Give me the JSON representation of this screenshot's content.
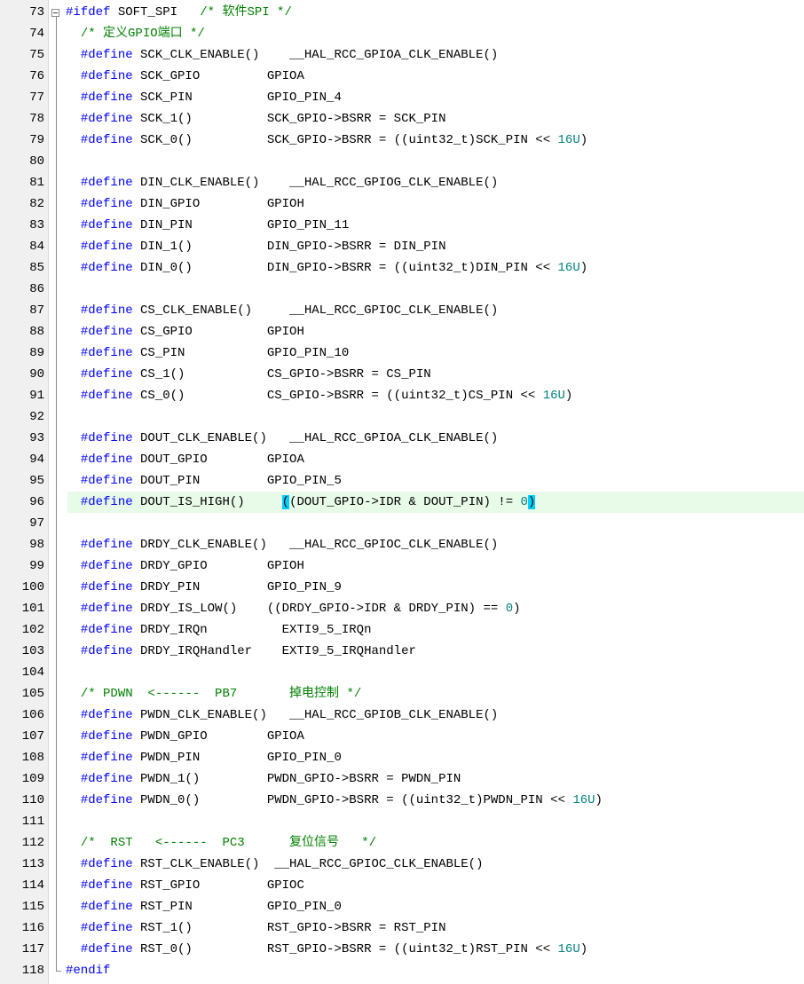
{
  "editor": {
    "line_numbers": [
      "73",
      "74",
      "75",
      "76",
      "77",
      "78",
      "79",
      "80",
      "81",
      "82",
      "83",
      "84",
      "85",
      "86",
      "87",
      "88",
      "89",
      "90",
      "91",
      "92",
      "93",
      "94",
      "95",
      "96",
      "97",
      "98",
      "99",
      "100",
      "101",
      "102",
      "103",
      "104",
      "105",
      "106",
      "107",
      "108",
      "109",
      "110",
      "111",
      "112",
      "113",
      "114",
      "115",
      "116",
      "117",
      "118"
    ],
    "current_line": "96",
    "lines": [
      [
        {
          "t": "kw",
          "v": "#ifdef"
        },
        {
          "t": "tx",
          "v": " SOFT_SPI   "
        },
        {
          "t": "cm",
          "v": "/* 软件SPI */"
        }
      ],
      [
        {
          "t": "tx",
          "v": "  "
        },
        {
          "t": "cm",
          "v": "/* 定义GPIO端口 */"
        }
      ],
      [
        {
          "t": "tx",
          "v": "  "
        },
        {
          "t": "kw",
          "v": "#define"
        },
        {
          "t": "tx",
          "v": " SCK_CLK_ENABLE()    __HAL_RCC_GPIOA_CLK_ENABLE()"
        }
      ],
      [
        {
          "t": "tx",
          "v": "  "
        },
        {
          "t": "kw",
          "v": "#define"
        },
        {
          "t": "tx",
          "v": " SCK_GPIO         GPIOA"
        }
      ],
      [
        {
          "t": "tx",
          "v": "  "
        },
        {
          "t": "kw",
          "v": "#define"
        },
        {
          "t": "tx",
          "v": " SCK_PIN          GPIO_PIN_4"
        }
      ],
      [
        {
          "t": "tx",
          "v": "  "
        },
        {
          "t": "kw",
          "v": "#define"
        },
        {
          "t": "tx",
          "v": " SCK_1()          SCK_GPIO->BSRR = SCK_PIN"
        }
      ],
      [
        {
          "t": "tx",
          "v": "  "
        },
        {
          "t": "kw",
          "v": "#define"
        },
        {
          "t": "tx",
          "v": " SCK_0()          SCK_GPIO->BSRR = ((uint32_t)SCK_PIN << "
        },
        {
          "t": "nm",
          "v": "16U"
        },
        {
          "t": "tx",
          "v": ")"
        }
      ],
      [],
      [
        {
          "t": "tx",
          "v": "  "
        },
        {
          "t": "kw",
          "v": "#define"
        },
        {
          "t": "tx",
          "v": " DIN_CLK_ENABLE()    __HAL_RCC_GPIOG_CLK_ENABLE()"
        }
      ],
      [
        {
          "t": "tx",
          "v": "  "
        },
        {
          "t": "kw",
          "v": "#define"
        },
        {
          "t": "tx",
          "v": " DIN_GPIO         GPIOH"
        }
      ],
      [
        {
          "t": "tx",
          "v": "  "
        },
        {
          "t": "kw",
          "v": "#define"
        },
        {
          "t": "tx",
          "v": " DIN_PIN          GPIO_PIN_11"
        }
      ],
      [
        {
          "t": "tx",
          "v": "  "
        },
        {
          "t": "kw",
          "v": "#define"
        },
        {
          "t": "tx",
          "v": " DIN_1()          DIN_GPIO->BSRR = DIN_PIN"
        }
      ],
      [
        {
          "t": "tx",
          "v": "  "
        },
        {
          "t": "kw",
          "v": "#define"
        },
        {
          "t": "tx",
          "v": " DIN_0()          DIN_GPIO->BSRR = ((uint32_t)DIN_PIN << "
        },
        {
          "t": "nm",
          "v": "16U"
        },
        {
          "t": "tx",
          "v": ")"
        }
      ],
      [],
      [
        {
          "t": "tx",
          "v": "  "
        },
        {
          "t": "kw",
          "v": "#define"
        },
        {
          "t": "tx",
          "v": " CS_CLK_ENABLE()     __HAL_RCC_GPIOC_CLK_ENABLE()"
        }
      ],
      [
        {
          "t": "tx",
          "v": "  "
        },
        {
          "t": "kw",
          "v": "#define"
        },
        {
          "t": "tx",
          "v": " CS_GPIO          GPIOH"
        }
      ],
      [
        {
          "t": "tx",
          "v": "  "
        },
        {
          "t": "kw",
          "v": "#define"
        },
        {
          "t": "tx",
          "v": " CS_PIN           GPIO_PIN_10"
        }
      ],
      [
        {
          "t": "tx",
          "v": "  "
        },
        {
          "t": "kw",
          "v": "#define"
        },
        {
          "t": "tx",
          "v": " CS_1()           CS_GPIO->BSRR = CS_PIN"
        }
      ],
      [
        {
          "t": "tx",
          "v": "  "
        },
        {
          "t": "kw",
          "v": "#define"
        },
        {
          "t": "tx",
          "v": " CS_0()           CS_GPIO->BSRR = ((uint32_t)CS_PIN << "
        },
        {
          "t": "nm",
          "v": "16U"
        },
        {
          "t": "tx",
          "v": ")"
        }
      ],
      [],
      [
        {
          "t": "tx",
          "v": "  "
        },
        {
          "t": "kw",
          "v": "#define"
        },
        {
          "t": "tx",
          "v": " DOUT_CLK_ENABLE()   __HAL_RCC_GPIOA_CLK_ENABLE()"
        }
      ],
      [
        {
          "t": "tx",
          "v": "  "
        },
        {
          "t": "kw",
          "v": "#define"
        },
        {
          "t": "tx",
          "v": " DOUT_GPIO        GPIOA"
        }
      ],
      [
        {
          "t": "tx",
          "v": "  "
        },
        {
          "t": "kw",
          "v": "#define"
        },
        {
          "t": "tx",
          "v": " DOUT_PIN         GPIO_PIN_5"
        }
      ],
      [
        {
          "t": "tx",
          "v": "  "
        },
        {
          "t": "kw",
          "v": "#define"
        },
        {
          "t": "tx",
          "v": " DOUT_IS_HIGH()     "
        },
        {
          "t": "brace",
          "v": "("
        },
        {
          "t": "tx",
          "v": "(DOUT_GPIO->IDR & DOUT_PIN) != "
        },
        {
          "t": "nm",
          "v": "0"
        },
        {
          "t": "brace",
          "v": ")"
        }
      ],
      [],
      [
        {
          "t": "tx",
          "v": "  "
        },
        {
          "t": "kw",
          "v": "#define"
        },
        {
          "t": "tx",
          "v": " DRDY_CLK_ENABLE()   __HAL_RCC_GPIOC_CLK_ENABLE()"
        }
      ],
      [
        {
          "t": "tx",
          "v": "  "
        },
        {
          "t": "kw",
          "v": "#define"
        },
        {
          "t": "tx",
          "v": " DRDY_GPIO        GPIOH"
        }
      ],
      [
        {
          "t": "tx",
          "v": "  "
        },
        {
          "t": "kw",
          "v": "#define"
        },
        {
          "t": "tx",
          "v": " DRDY_PIN         GPIO_PIN_9"
        }
      ],
      [
        {
          "t": "tx",
          "v": "  "
        },
        {
          "t": "kw",
          "v": "#define"
        },
        {
          "t": "tx",
          "v": " DRDY_IS_LOW()    ((DRDY_GPIO->IDR & DRDY_PIN) == "
        },
        {
          "t": "nm",
          "v": "0"
        },
        {
          "t": "tx",
          "v": ")"
        }
      ],
      [
        {
          "t": "tx",
          "v": "  "
        },
        {
          "t": "kw",
          "v": "#define"
        },
        {
          "t": "tx",
          "v": " DRDY_IRQn          EXTI9_5_IRQn"
        }
      ],
      [
        {
          "t": "tx",
          "v": "  "
        },
        {
          "t": "kw",
          "v": "#define"
        },
        {
          "t": "tx",
          "v": " DRDY_IRQHandler    EXTI9_5_IRQHandler"
        }
      ],
      [],
      [
        {
          "t": "tx",
          "v": "  "
        },
        {
          "t": "cm",
          "v": "/* PDWN  <------  PB7       掉电控制 */"
        }
      ],
      [
        {
          "t": "tx",
          "v": "  "
        },
        {
          "t": "kw",
          "v": "#define"
        },
        {
          "t": "tx",
          "v": " PWDN_CLK_ENABLE()   __HAL_RCC_GPIOB_CLK_ENABLE()"
        }
      ],
      [
        {
          "t": "tx",
          "v": "  "
        },
        {
          "t": "kw",
          "v": "#define"
        },
        {
          "t": "tx",
          "v": " PWDN_GPIO        GPIOA"
        }
      ],
      [
        {
          "t": "tx",
          "v": "  "
        },
        {
          "t": "kw",
          "v": "#define"
        },
        {
          "t": "tx",
          "v": " PWDN_PIN         GPIO_PIN_0"
        }
      ],
      [
        {
          "t": "tx",
          "v": "  "
        },
        {
          "t": "kw",
          "v": "#define"
        },
        {
          "t": "tx",
          "v": " PWDN_1()         PWDN_GPIO->BSRR = PWDN_PIN"
        }
      ],
      [
        {
          "t": "tx",
          "v": "  "
        },
        {
          "t": "kw",
          "v": "#define"
        },
        {
          "t": "tx",
          "v": " PWDN_0()         PWDN_GPIO->BSRR = ((uint32_t)PWDN_PIN << "
        },
        {
          "t": "nm",
          "v": "16U"
        },
        {
          "t": "tx",
          "v": ")"
        }
      ],
      [],
      [
        {
          "t": "tx",
          "v": "  "
        },
        {
          "t": "cm",
          "v": "/*  RST   <------  PC3      复位信号   */"
        }
      ],
      [
        {
          "t": "tx",
          "v": "  "
        },
        {
          "t": "kw",
          "v": "#define"
        },
        {
          "t": "tx",
          "v": " RST_CLK_ENABLE()  __HAL_RCC_GPIOC_CLK_ENABLE()"
        }
      ],
      [
        {
          "t": "tx",
          "v": "  "
        },
        {
          "t": "kw",
          "v": "#define"
        },
        {
          "t": "tx",
          "v": " RST_GPIO         GPIOC"
        }
      ],
      [
        {
          "t": "tx",
          "v": "  "
        },
        {
          "t": "kw",
          "v": "#define"
        },
        {
          "t": "tx",
          "v": " RST_PIN          GPIO_PIN_0"
        }
      ],
      [
        {
          "t": "tx",
          "v": "  "
        },
        {
          "t": "kw",
          "v": "#define"
        },
        {
          "t": "tx",
          "v": " RST_1()          RST_GPIO->BSRR = RST_PIN"
        }
      ],
      [
        {
          "t": "tx",
          "v": "  "
        },
        {
          "t": "kw",
          "v": "#define"
        },
        {
          "t": "tx",
          "v": " RST_0()          RST_GPIO->BSRR = ((uint32_t)RST_PIN << "
        },
        {
          "t": "nm",
          "v": "16U"
        },
        {
          "t": "tx",
          "v": ")"
        }
      ],
      [
        {
          "t": "kw",
          "v": "#endif"
        }
      ]
    ]
  }
}
